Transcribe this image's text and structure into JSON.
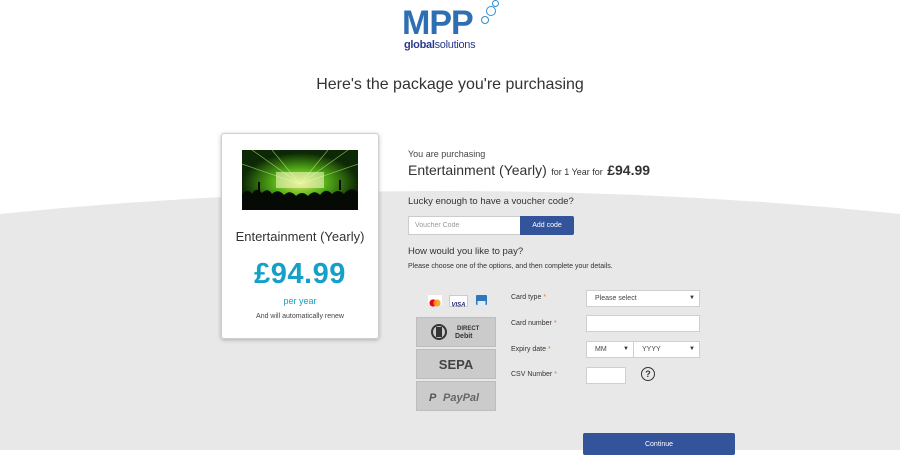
{
  "brand": {
    "logo_main": "MPP",
    "logo_sub_bold": "global",
    "logo_sub_rest": "solutions"
  },
  "page_title": "Here's the package you're purchasing",
  "product_card": {
    "name": "Entertainment (Yearly)",
    "price": "£94.99",
    "period": "per year",
    "renew_note": "And will automatically renew"
  },
  "purchase": {
    "label": "You are purchasing",
    "product": "Entertainment (Yearly)",
    "term": "for 1 Year for",
    "price": "£94.99"
  },
  "voucher": {
    "question": "Lucky enough to have a voucher code?",
    "placeholder": "Voucher Code",
    "button": "Add code"
  },
  "payment": {
    "question": "How would you like to pay?",
    "instructions": "Please choose one of the options, and then complete your details.",
    "methods": [
      {
        "name": "Card",
        "icons": [
          "mastercard-icon",
          "visa-icon",
          "amex-icon"
        ]
      },
      {
        "name": "Direct Debit",
        "line1": "DIRECT",
        "line2": "Debit"
      },
      {
        "name": "SEPA",
        "text": "SEPA"
      },
      {
        "name": "PayPal",
        "text": "PayPal"
      }
    ]
  },
  "form": {
    "card_type_label": "Card type",
    "card_type_value": "Please select",
    "card_number_label": "Card number",
    "card_number_value": "",
    "expiry_label": "Expiry date",
    "expiry_month": "MM",
    "expiry_year": "YYYY",
    "csv_label": "CSV Number",
    "csv_value": "",
    "required_mark": "*",
    "help_icon": "?"
  },
  "continue_label": "Continue",
  "colors": {
    "accent_blue": "#33539a",
    "price_teal": "#16a0c8",
    "bg_gray": "#e8e8e8",
    "required_orange": "#e07a2a"
  }
}
